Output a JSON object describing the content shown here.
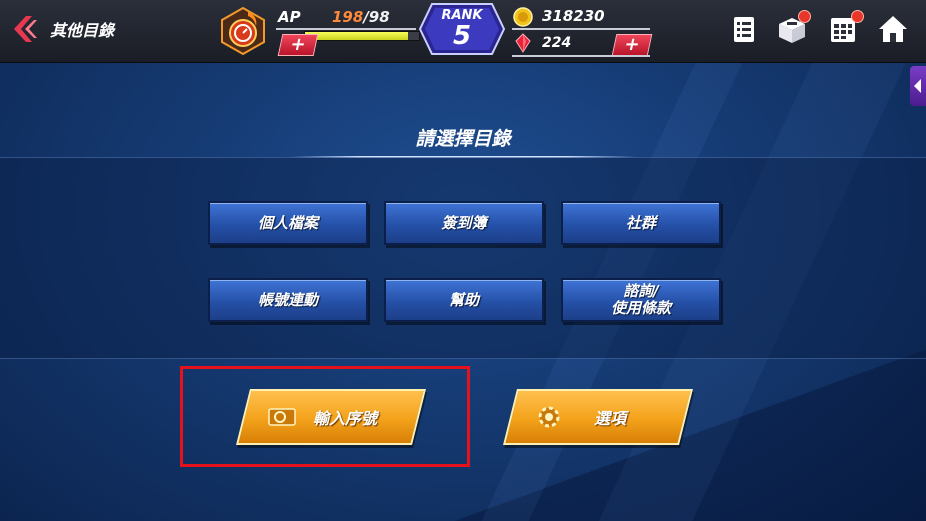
{
  "header": {
    "back_label": "其他目錄",
    "ap": {
      "label": "AP",
      "current": "198",
      "max": "98",
      "separator": "/",
      "fill_ratio": 0.9
    },
    "rank": {
      "label": "RANK",
      "value": "5"
    },
    "coins": "318230",
    "gems": "224",
    "plus_symbol": "+"
  },
  "icons": [
    "menu-list-icon",
    "gift-box-icon",
    "calendar-icon",
    "home-icon"
  ],
  "title": "請選擇目錄",
  "menu": {
    "profile": "個人檔案",
    "checkin": "簽到簿",
    "community": "社群",
    "account_link": "帳號連動",
    "help": "幫助",
    "inquiry_terms": "諮詢/\n使用條款"
  },
  "actions": {
    "serial_code": "輸入序號",
    "options": "選項"
  },
  "colors": {
    "accent_orange": "#f3a21a",
    "button_blue": "#2551a8",
    "highlight_red": "#e5121c"
  }
}
